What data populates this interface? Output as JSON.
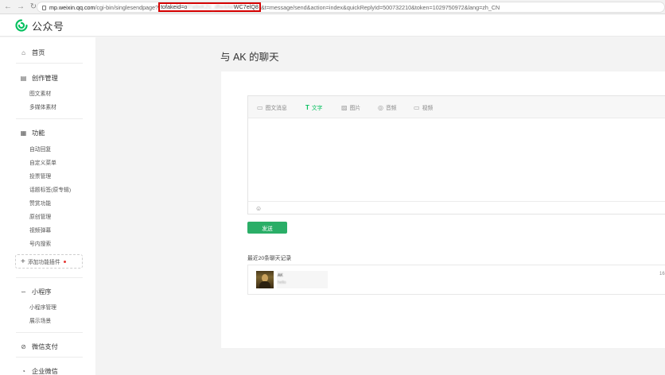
{
  "browser": {
    "back": "←",
    "forward": "→",
    "reload": "↻",
    "url_host": "mp.weixin.qq.com",
    "url_path": "/cgi-bin/singlesendpage?",
    "url_highlight_prefix": "tofakeid=o",
    "url_highlight_blurred": "f7a9xKZc_dfw4Ae",
    "url_highlight_suffix": "WC7elQ8",
    "url_rest": "&t=message/send&action=index&quickReplyId=500732210&token=1029750972&lang=zh_CN"
  },
  "header": {
    "logo_text": "公众号",
    "logo_icon": "wechat-official-account-icon"
  },
  "sidebar": {
    "home": {
      "label": "首页",
      "icon": "home-icon"
    },
    "create": {
      "label": "创作管理",
      "icon": "document-icon",
      "items": [
        "图文素材",
        "多媒体素材"
      ]
    },
    "features": {
      "label": "功能",
      "icon": "grid-icon",
      "items": [
        "自动回复",
        "自定义菜单",
        "投票管理",
        "话题标签(原专辑)",
        "赞赏功能",
        "原创管理",
        "视频弹幕",
        "号内搜索"
      ]
    },
    "add_plugin": "添加功能插件",
    "miniprogram": {
      "label": "小程序",
      "icon": "link-icon",
      "items": [
        "小程序管理",
        "展示场景"
      ]
    },
    "wechat_pay": {
      "label": "微信支付",
      "icon": "pay-icon"
    },
    "work_wechat": {
      "label": "企业微信",
      "icon": "chat-icon"
    }
  },
  "main": {
    "title": "与 AK 的聊天",
    "toolbar": [
      {
        "label": "图文消息",
        "icon": "article-icon",
        "active": false
      },
      {
        "label": "文字",
        "icon": "text-icon",
        "active": true
      },
      {
        "label": "图片",
        "icon": "image-icon",
        "active": false
      },
      {
        "label": "音频",
        "icon": "audio-icon",
        "active": false
      },
      {
        "label": "视频",
        "icon": "video-icon",
        "active": false
      }
    ],
    "send_label": "发送",
    "history_title": "最近20条聊天记录",
    "history": [
      {
        "name": "AK",
        "text": "hello",
        "time": "16"
      }
    ]
  },
  "colors": {
    "accent": "#07c160",
    "send_button": "#2aae67",
    "highlight_border": "#d60000"
  }
}
